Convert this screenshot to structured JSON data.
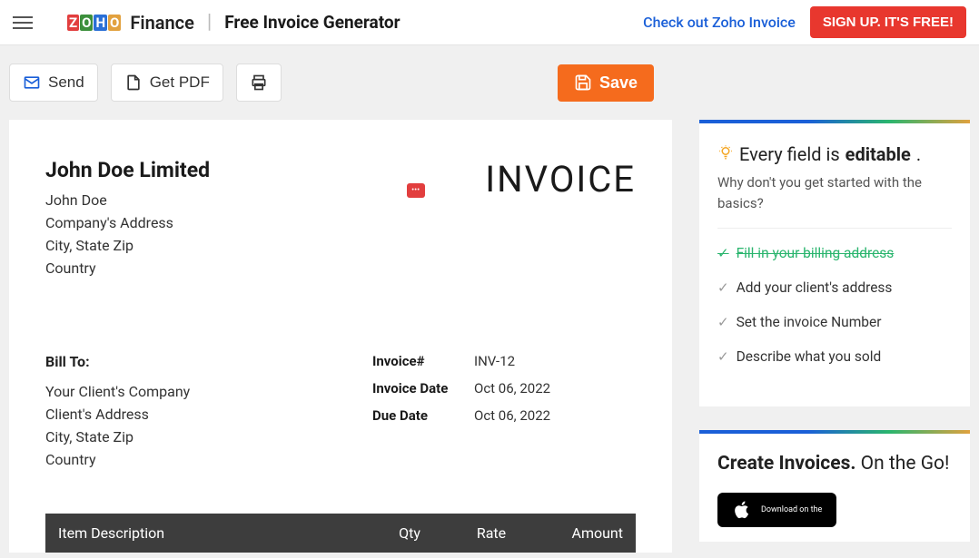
{
  "header": {
    "finance": "Finance",
    "page_title": "Free Invoice Generator",
    "checkout_link": "Check out Zoho Invoice",
    "signup": "SIGN UP. IT'S FREE!"
  },
  "toolbar": {
    "send": "Send",
    "getpdf": "Get PDF",
    "save": "Save"
  },
  "invoice": {
    "company_name": "John Doe Limited",
    "contact": "John Doe",
    "addr1": "Company's Address",
    "addr2": "City, State Zip",
    "addr3": "Country",
    "title": "INVOICE",
    "bill_to_label": "Bill To:",
    "client_company": "Your Client's Company",
    "client_addr1": "Client's Address",
    "client_addr2": "City, State Zip",
    "client_addr3": "Country",
    "meta": {
      "invnum_label": "Invoice#",
      "invnum": "INV-12",
      "date_label": "Invoice Date",
      "date": "Oct 06, 2022",
      "due_label": "Due Date",
      "due": "Oct 06, 2022"
    },
    "cols": {
      "desc": "Item Description",
      "qty": "Qty",
      "rate": "Rate",
      "amount": "Amount"
    }
  },
  "sidebar": {
    "tip_prefix": "Every field is ",
    "tip_bold": "editable",
    "tip_suffix": ".",
    "tip_sub": "Why don't you get started with the basics?",
    "checklist": [
      {
        "label": "Fill in your billing address",
        "done": true
      },
      {
        "label": "Add your client's address",
        "done": false
      },
      {
        "label": "Set the invoice Number",
        "done": false
      },
      {
        "label": "Describe what you sold",
        "done": false
      }
    ],
    "go_title_bold": "Create Invoices.",
    "go_title_light": " On the Go!",
    "appstore_small": "Download on the"
  }
}
